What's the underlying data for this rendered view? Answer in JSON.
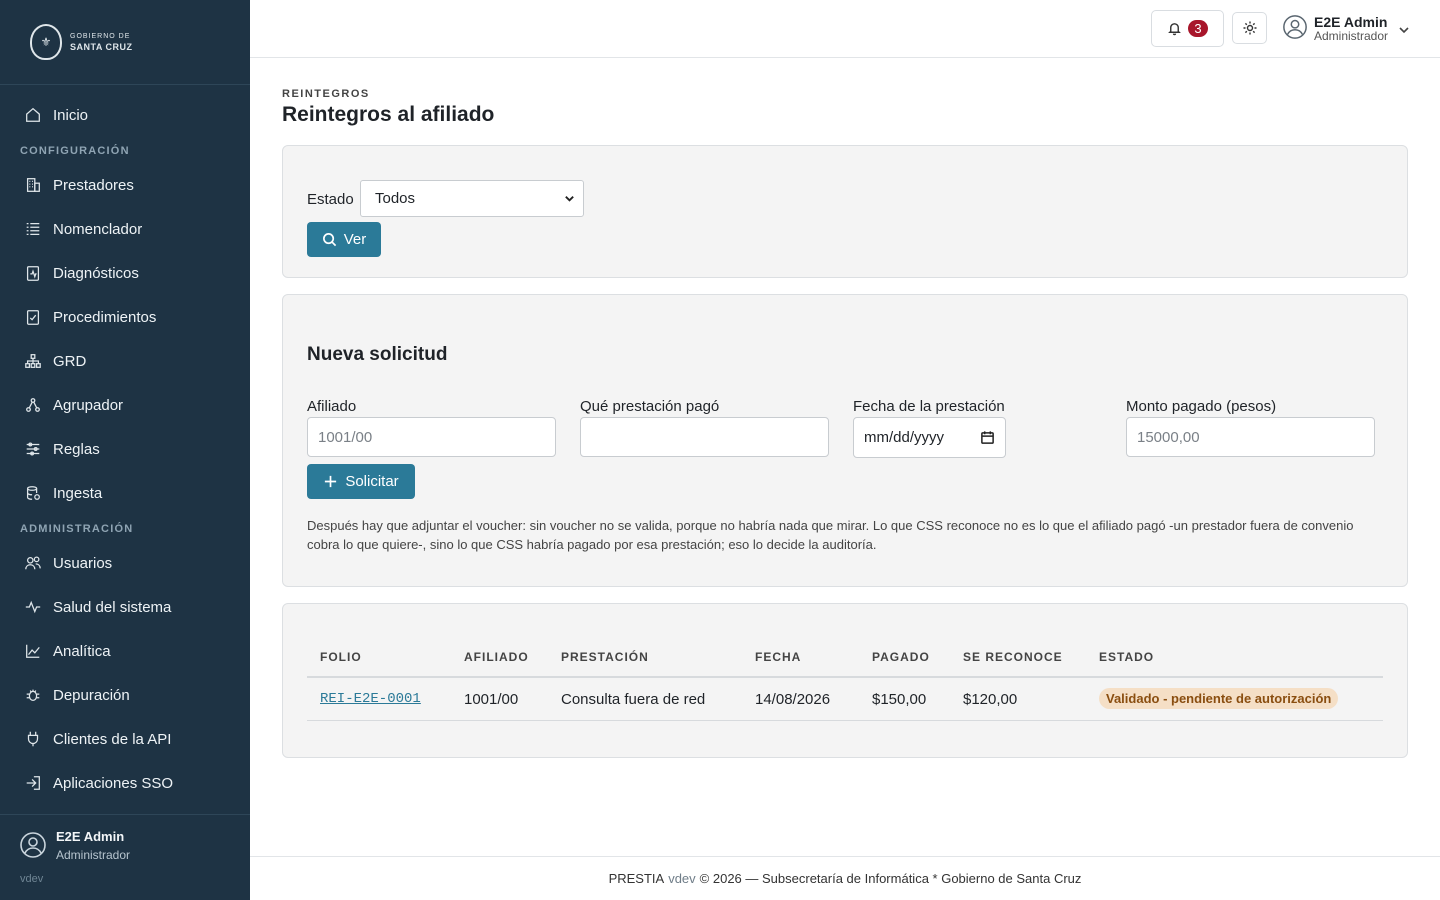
{
  "brand": {
    "seal_glyph": "⚜",
    "line1": "GOBIERNO DE",
    "line2": "SANTA CRUZ"
  },
  "sidebar": {
    "items_top": [
      {
        "label": "Inicio",
        "icon": "home-icon"
      }
    ],
    "section_config": "CONFIGURACIÓN",
    "items_config": [
      {
        "label": "Prestadores",
        "icon": "building-icon"
      },
      {
        "label": "Nomenclador",
        "icon": "list-icon"
      },
      {
        "label": "Diagnósticos",
        "icon": "clipboard-pulse-icon"
      },
      {
        "label": "Procedimientos",
        "icon": "clipboard-check-icon"
      },
      {
        "label": "GRD",
        "icon": "hierarchy-icon"
      },
      {
        "label": "Agrupador",
        "icon": "group-icon"
      },
      {
        "label": "Reglas",
        "icon": "sliders-icon"
      },
      {
        "label": "Ingesta",
        "icon": "database-icon"
      }
    ],
    "section_admin": "ADMINISTRACIÓN",
    "items_admin": [
      {
        "label": "Usuarios",
        "icon": "users-icon"
      },
      {
        "label": "Salud del sistema",
        "icon": "activity-icon"
      },
      {
        "label": "Analítica",
        "icon": "chart-line-icon"
      },
      {
        "label": "Depuración",
        "icon": "bug-icon"
      },
      {
        "label": "Clientes de la API",
        "icon": "plug-icon"
      },
      {
        "label": "Aplicaciones SSO",
        "icon": "login-icon"
      }
    ],
    "user": {
      "name": "E2E Admin",
      "role": "Administrador",
      "version": "vdev"
    }
  },
  "topbar": {
    "notification_count": "3",
    "user_name": "E2E Admin",
    "user_role": "Administrador"
  },
  "page": {
    "overline": "REINTEGROS",
    "title": "Reintegros al afiliado"
  },
  "filter": {
    "label": "Estado",
    "selected": "Todos",
    "button": "Ver"
  },
  "form": {
    "title": "Nueva solicitud",
    "fields": [
      {
        "label": "Afiliado",
        "placeholder": "1001/00"
      },
      {
        "label": "Qué prestación pagó",
        "placeholder": ""
      },
      {
        "label": "Fecha de la prestación",
        "value": "mm/dd/yyyy"
      },
      {
        "label": "Monto pagado (pesos)",
        "placeholder": "15000,00"
      }
    ],
    "button": "Solicitar",
    "help": "Después hay que adjuntar el voucher: sin voucher no se valida, porque no habría nada que mirar. Lo que CSS reconoce no es lo que el afiliado pagó -un prestador fuera de convenio cobra lo que quiere-, sino lo que CSS habría pagado por esa prestación; eso lo decide la auditoría."
  },
  "table": {
    "headers": [
      "FOLIO",
      "AFILIADO",
      "PRESTACIÓN",
      "FECHA",
      "PAGADO",
      "SE RECONOCE",
      "ESTADO"
    ],
    "rows": [
      {
        "folio": "REI-E2E-0001",
        "afiliado": "1001/00",
        "prestacion": "Consulta fuera de red",
        "fecha": "14/08/2026",
        "pagado": "$150,00",
        "reconoce": "$120,00",
        "estado": "Validado - pendiente de autorización"
      }
    ]
  },
  "footer": {
    "product": "PRESTIA",
    "version": "vdev",
    "rest": "© 2026 — Subsecretaría de Informática * Gobierno de Santa Cruz"
  },
  "colors": {
    "sidebar_bg": "#1e3344",
    "accent": "#2b7a98",
    "badge_red": "#a8162b",
    "status_bg": "#f5dfc6"
  }
}
